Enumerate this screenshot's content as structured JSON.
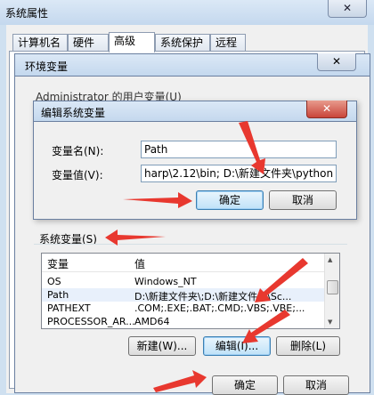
{
  "window": {
    "title": "系统属性",
    "close": "✕"
  },
  "tabs": [
    {
      "label": "计算机名"
    },
    {
      "label": "硬件"
    },
    {
      "label": "高级"
    },
    {
      "label": "系统保护"
    },
    {
      "label": "远程"
    }
  ],
  "env_dialog": {
    "title": "环境变量",
    "close": "✕",
    "user_section_label": "Administrator 的用户变量(U)"
  },
  "edit_dialog": {
    "title": "编辑系统变量",
    "close": "✕",
    "name_label": "变量名(N):",
    "name_value": "Path",
    "value_label": "变量值(V):",
    "value_value": "harp\\2.12\\bin; D:\\新建文件夹\\python",
    "ok": "确定",
    "cancel": "取消"
  },
  "system_vars": {
    "label": "系统变量(S)",
    "columns": [
      "变量",
      "值"
    ],
    "rows": [
      {
        "name": "OS",
        "value": "Windows_NT"
      },
      {
        "name": "Path",
        "value": "D:\\新建文件夹\\;D:\\新建文件夹\\Sc..."
      },
      {
        "name": "PATHEXT",
        "value": ".COM;.EXE;.BAT;.CMD;.VBS;.VBE;..."
      },
      {
        "name": "PROCESSOR_AR...",
        "value": "AMD64"
      }
    ],
    "new_button": "新建(W)...",
    "edit_button": "编辑(I)...",
    "delete_button": "删除(L)"
  },
  "env_buttons": {
    "ok": "确定",
    "cancel": "取消"
  },
  "colors": {
    "annotation_arrow": "#e8382f",
    "title_bar": "#c4d8ee"
  }
}
